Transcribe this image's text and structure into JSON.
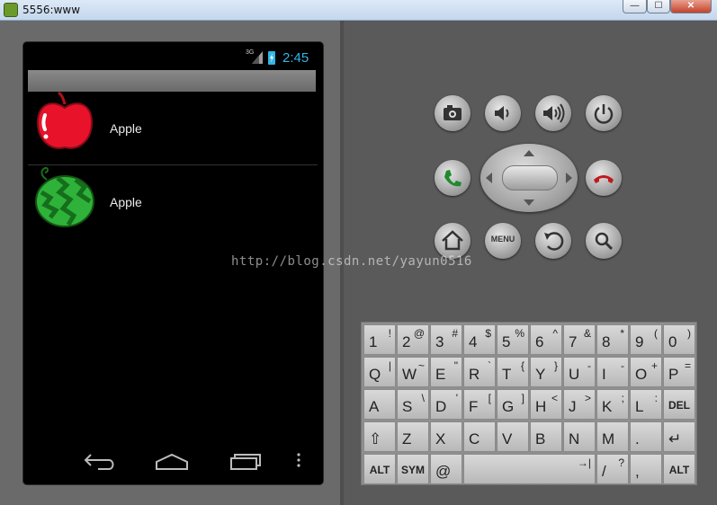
{
  "window": {
    "title": "5556:www",
    "minimize_glyph": "—",
    "maximize_glyph": "☐",
    "close_glyph": "✕"
  },
  "phone": {
    "status_bar": {
      "network": "3G",
      "time": "2:45"
    },
    "list_items": [
      {
        "label": "Apple",
        "icon": "apple-icon"
      },
      {
        "label": "Apple",
        "icon": "watermelon-icon"
      }
    ],
    "nav": [
      "back-icon",
      "home-icon",
      "recent-apps-icon",
      "overflow-menu-icon"
    ]
  },
  "controls": {
    "menu_label": "MENU"
  },
  "keyboard": {
    "rows": [
      [
        {
          "main": "1",
          "alt": "!"
        },
        {
          "main": "2",
          "alt": "@"
        },
        {
          "main": "3",
          "alt": "#"
        },
        {
          "main": "4",
          "alt": "$"
        },
        {
          "main": "5",
          "alt": "%"
        },
        {
          "main": "6",
          "alt": "^"
        },
        {
          "main": "7",
          "alt": "&"
        },
        {
          "main": "8",
          "alt": "*"
        },
        {
          "main": "9",
          "alt": "("
        },
        {
          "main": "0",
          "alt": ")"
        }
      ],
      [
        {
          "main": "Q",
          "alt": "|"
        },
        {
          "main": "W",
          "alt": "~"
        },
        {
          "main": "E",
          "alt": "\""
        },
        {
          "main": "R",
          "alt": "`"
        },
        {
          "main": "T",
          "alt": "{"
        },
        {
          "main": "Y",
          "alt": "}"
        },
        {
          "main": "U",
          "alt": "-"
        },
        {
          "main": "I",
          "alt": "-"
        },
        {
          "main": "O",
          "alt": "+"
        },
        {
          "main": "P",
          "alt": "="
        }
      ],
      [
        {
          "main": "A",
          "alt": ""
        },
        {
          "main": "S",
          "alt": "\\"
        },
        {
          "main": "D",
          "alt": "'"
        },
        {
          "main": "F",
          "alt": "["
        },
        {
          "main": "G",
          "alt": "]"
        },
        {
          "main": "H",
          "alt": "<"
        },
        {
          "main": "J",
          "alt": ">"
        },
        {
          "main": "K",
          "alt": ";"
        },
        {
          "main": "L",
          "alt": ":"
        },
        {
          "main": "DEL",
          "alt": ""
        }
      ],
      [
        {
          "main": "⇧",
          "alt": ""
        },
        {
          "main": "Z",
          "alt": ""
        },
        {
          "main": "X",
          "alt": ""
        },
        {
          "main": "C",
          "alt": ""
        },
        {
          "main": "V",
          "alt": ""
        },
        {
          "main": "B",
          "alt": ""
        },
        {
          "main": "N",
          "alt": ""
        },
        {
          "main": "M",
          "alt": ""
        },
        {
          "main": ".",
          "alt": ""
        },
        {
          "main": "↵",
          "alt": ""
        }
      ],
      [
        {
          "main": "ALT",
          "alt": ""
        },
        {
          "main": "SYM",
          "alt": ""
        },
        {
          "main": "@",
          "alt": ""
        },
        {
          "main": "",
          "alt": "→|"
        },
        {
          "main": "/",
          "alt": "?"
        },
        {
          "main": ",",
          "alt": ""
        },
        {
          "main": "ALT",
          "alt": ""
        }
      ]
    ]
  },
  "watermark": "http://blog.csdn.net/yayun0516",
  "colors": {
    "accent": "#33b5e5",
    "screen_bg": "#000000",
    "body_bg": "#5a5a5a"
  }
}
